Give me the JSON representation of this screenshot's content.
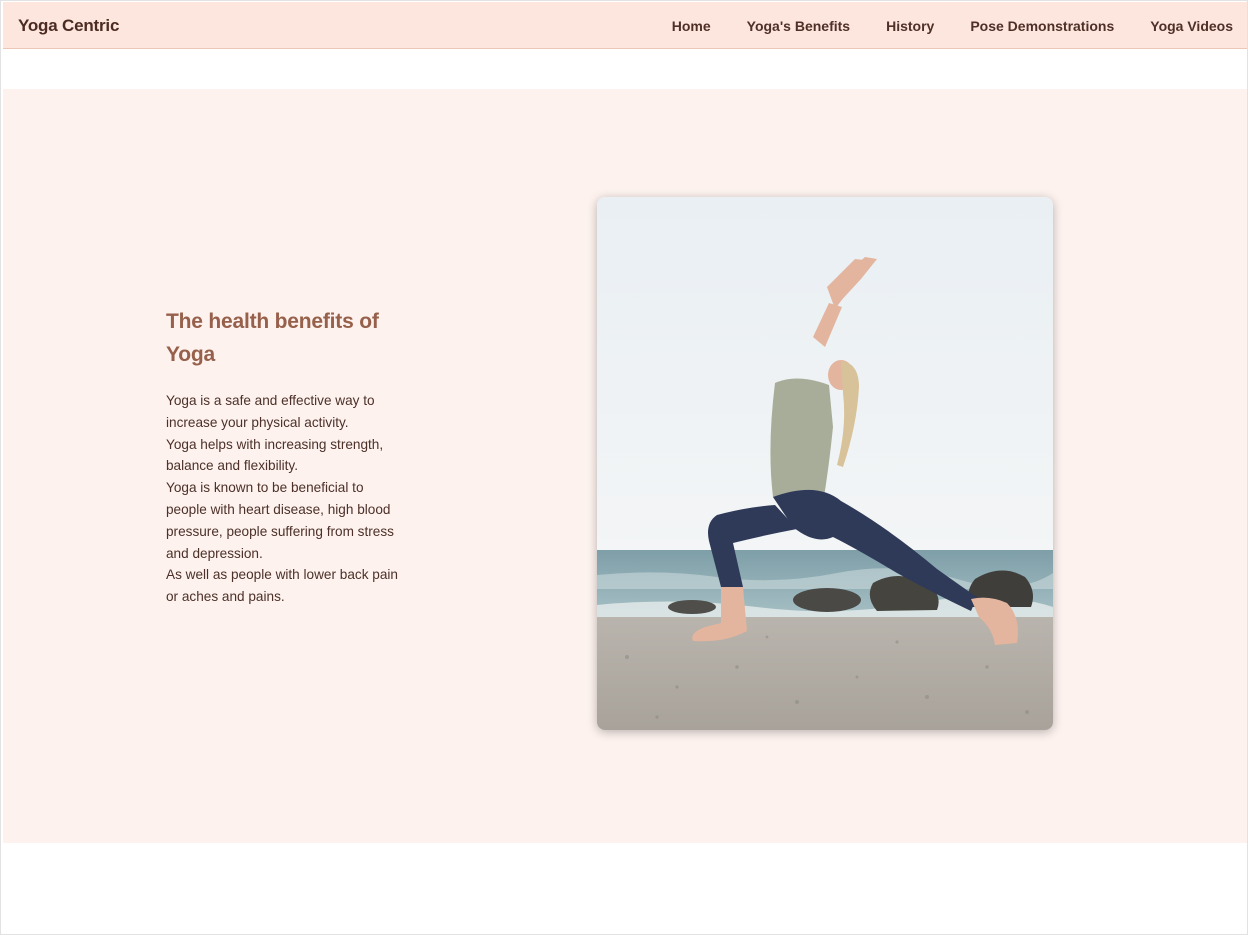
{
  "header": {
    "brand": "Yoga Centric",
    "nav_items": [
      {
        "label": "Home"
      },
      {
        "label": "Yoga's Benefits"
      },
      {
        "label": "History"
      },
      {
        "label": "Pose Demonstrations"
      },
      {
        "label": "Yoga Videos"
      }
    ]
  },
  "hero": {
    "title": "The health benefits of Yoga",
    "paragraphs": [
      "Yoga is a safe and effective way to increase your physical activity.",
      "Yoga helps with increasing strength, balance and flexibility.",
      "Yoga is known to be beneficial to people with heart disease, high blood pressure, people suffering from stress and depression.",
      "As well as people with lower back pain or aches and pains."
    ],
    "image": {
      "subject": "woman-in-yoga-warrior-pose-on-beach"
    }
  },
  "colors": {
    "navbar_bg": "#fce6de",
    "hero_bg": "#fdf2ee",
    "headline": "#96604a",
    "text": "#4c3029"
  }
}
